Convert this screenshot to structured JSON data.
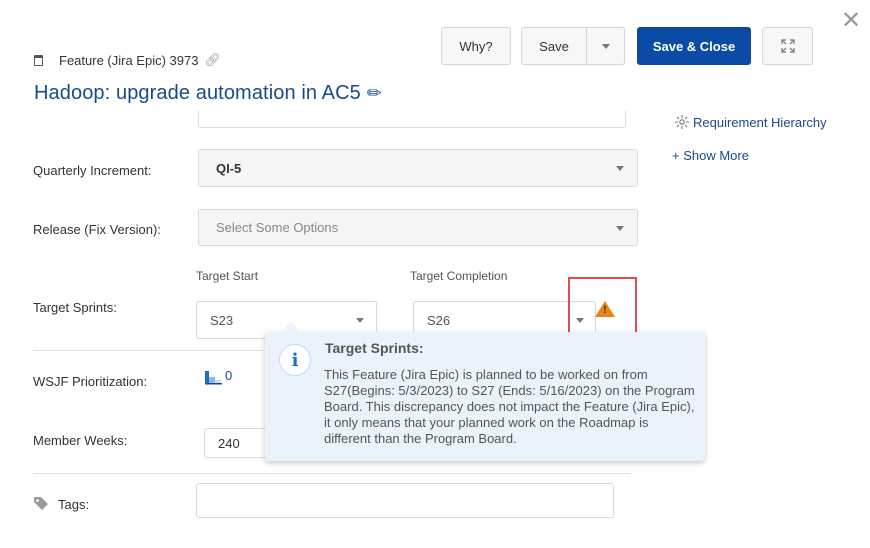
{
  "header": {
    "item_type": "Feature (Jira Epic) 3973",
    "title": "Hadoop: upgrade automation in AC5",
    "buttons": {
      "why": "Why?",
      "save": "Save",
      "save_close": "Save & Close"
    }
  },
  "side_panel": {
    "requirement_hierarchy": "Requirement Hierarchy",
    "show_more": "+ Show More"
  },
  "form": {
    "quarterly_increment": {
      "label": "Quarterly Increment:",
      "value": "QI-5"
    },
    "release": {
      "label": "Release (Fix Version):",
      "placeholder": "Select Some Options"
    },
    "target_sprints": {
      "label": "Target Sprints:",
      "start_label": "Target Start",
      "start_value": "S23",
      "completion_label": "Target Completion",
      "completion_value": "S26"
    },
    "wsjf": {
      "label": "WSJF Prioritization:",
      "value": "0"
    },
    "member_weeks": {
      "label": "Member Weeks:",
      "value": "240"
    },
    "tags": {
      "label": "Tags:"
    }
  },
  "tooltip": {
    "title": "Target Sprints:",
    "body": "This Feature (Jira Epic) is planned to be worked on from S27(Begins: 5/3/2023) to S27 (Ends: 5/16/2023) on the Program Board. This discrepancy does not impact the Feature (Jira Epic), it only means that your planned work on the Roadmap is different than the Program Board."
  },
  "colors": {
    "primary": "#0b4aa5",
    "title_blue": "#1a4a8a",
    "warning": "#e8861c",
    "highlight": "#e14b4b",
    "tooltip_bg": "#eaf2fb"
  }
}
